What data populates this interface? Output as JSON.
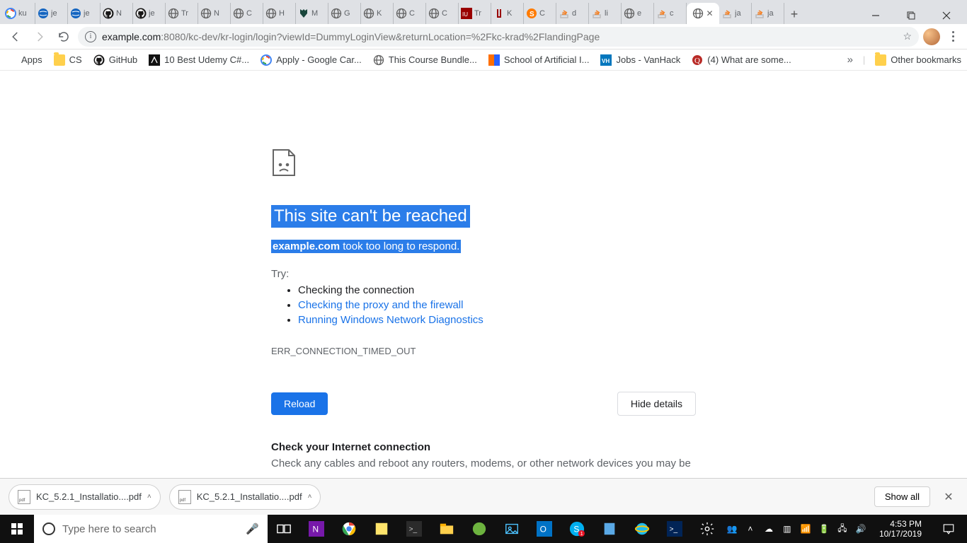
{
  "tabs": [
    {
      "label": "ku",
      "icon": "google"
    },
    {
      "label": "je",
      "icon": "globe-blue"
    },
    {
      "label": "je",
      "icon": "globe-blue"
    },
    {
      "label": "N",
      "icon": "github"
    },
    {
      "label": "je",
      "icon": "github"
    },
    {
      "label": "Tr",
      "icon": "globe"
    },
    {
      "label": "N",
      "icon": "globe"
    },
    {
      "label": "C",
      "icon": "globe"
    },
    {
      "label": "H",
      "icon": "globe"
    },
    {
      "label": "M",
      "icon": "spartan"
    },
    {
      "label": "G",
      "icon": "globe"
    },
    {
      "label": "K",
      "icon": "globe"
    },
    {
      "label": "C",
      "icon": "globe"
    },
    {
      "label": "C",
      "icon": "globe"
    },
    {
      "label": "Tr",
      "icon": "iu-red"
    },
    {
      "label": "K",
      "icon": "iu"
    },
    {
      "label": "C",
      "icon": "skype"
    },
    {
      "label": "d",
      "icon": "so"
    },
    {
      "label": "li",
      "icon": "so"
    },
    {
      "label": "e",
      "icon": "globe"
    },
    {
      "label": "c",
      "icon": "so"
    },
    {
      "label": "",
      "icon": "globe",
      "active": true,
      "closable": true
    },
    {
      "label": "ja",
      "icon": "so"
    },
    {
      "label": "ja",
      "icon": "so"
    }
  ],
  "omnibox": {
    "host": "example.com",
    "port": ":8080",
    "path": "/kc-dev/kr-login/login?viewId=DummyLoginView&returnLocation=%2Fkc-krad%2FlandingPage"
  },
  "bookmarks_label": "Apps",
  "bookmarks": [
    {
      "label": "CS",
      "icon": "folder"
    },
    {
      "label": "GitHub",
      "icon": "github"
    },
    {
      "label": "10 Best Udemy C#...",
      "icon": "dark"
    },
    {
      "label": "Apply - Google Car...",
      "icon": "google"
    },
    {
      "label": "This Course Bundle...",
      "icon": "globe"
    },
    {
      "label": "School of Artificial I...",
      "icon": "color"
    },
    {
      "label": "Jobs - VanHack",
      "icon": "vh"
    },
    {
      "label": "(4) What are some...",
      "icon": "quora"
    }
  ],
  "bm_overflow": "»",
  "other_bookmarks": "Other bookmarks",
  "error": {
    "title": "This site can't be reached",
    "host": "example.com",
    "sub": " took too long to respond.",
    "try_label": "Try:",
    "items": {
      "plain": "Checking the connection",
      "link1": "Checking the proxy and the firewall",
      "link2": "Running Windows Network Diagnostics"
    },
    "code": "ERR_CONNECTION_TIMED_OUT",
    "reload": "Reload",
    "hide": "Hide details",
    "details_h": "Check your Internet connection",
    "details_p": "Check any cables and reboot any routers, modems, or other network devices you may be"
  },
  "downloads": {
    "file1": "KC_5.2.1_Installatio....pdf",
    "file2": "KC_5.2.1_Installatio....pdf",
    "showall": "Show all"
  },
  "taskbar": {
    "search_placeholder": "Type here to search",
    "time": "4:53 PM",
    "date": "10/17/2019"
  }
}
